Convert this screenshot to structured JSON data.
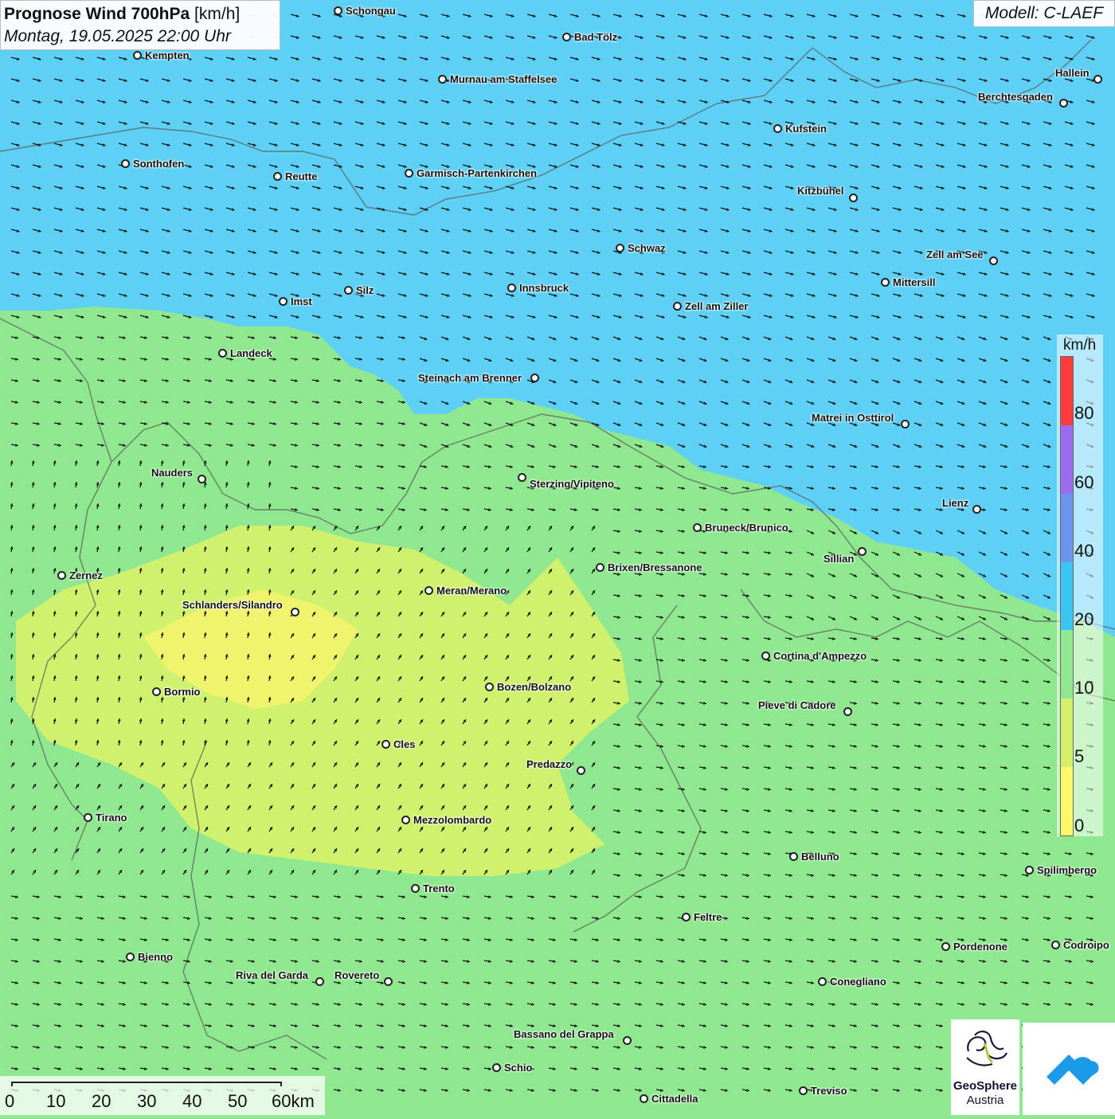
{
  "title": {
    "main": "Prognose Wind 700hPa",
    "unit": "[km/h]",
    "datetime": "Montag, 19.05.2025 22:00 Uhr"
  },
  "model": "Modell: C-LAEF",
  "legend": {
    "unit": "km/h",
    "ticks": [
      "80",
      "60",
      "40",
      "20",
      "10",
      "5",
      "0"
    ],
    "colors": [
      "#ff3b3b",
      "#9a6cf0",
      "#6e95ee",
      "#3ac6f2",
      "#8fe88f",
      "#d4f06a",
      "#fbf86a"
    ]
  },
  "scalebar": {
    "labels": [
      "0",
      "10",
      "20",
      "30",
      "40",
      "50",
      "60km"
    ]
  },
  "logos": {
    "geosphere_line1": "GeoSphere",
    "geosphere_line2": "Austria"
  },
  "cities": [
    {
      "name": "Schongau"
    },
    {
      "name": "Bad Tölz"
    },
    {
      "name": "Kempten"
    },
    {
      "name": "Murnau am Staffelsee"
    },
    {
      "name": "Hallein"
    },
    {
      "name": "Berchtesgaden"
    },
    {
      "name": "Kufstein"
    },
    {
      "name": "Sonthofen"
    },
    {
      "name": "Reutte"
    },
    {
      "name": "Garmisch-Partenkirchen"
    },
    {
      "name": "Kitzbühel"
    },
    {
      "name": "Schwaz"
    },
    {
      "name": "Zell am See"
    },
    {
      "name": "Mittersill"
    },
    {
      "name": "Innsbruck"
    },
    {
      "name": "Silz"
    },
    {
      "name": "Imst"
    },
    {
      "name": "Zell am Ziller"
    },
    {
      "name": "Landeck"
    },
    {
      "name": "Steinach am Brenner"
    },
    {
      "name": "Matrei in Osttirol"
    },
    {
      "name": "Nauders"
    },
    {
      "name": "Sterzing/Vipiteno"
    },
    {
      "name": "Lienz"
    },
    {
      "name": "Bruneck/Brunico"
    },
    {
      "name": "Sillian"
    },
    {
      "name": "Brixen/Bressanone"
    },
    {
      "name": "Zernez"
    },
    {
      "name": "Meran/Merano"
    },
    {
      "name": "Schlanders/Silandro"
    },
    {
      "name": "Cortina d'Ampezzo"
    },
    {
      "name": "Bozen/Bolzano"
    },
    {
      "name": "Bormio"
    },
    {
      "name": "Pieve di Cadore"
    },
    {
      "name": "Cles"
    },
    {
      "name": "Predazzo"
    },
    {
      "name": "Tirano"
    },
    {
      "name": "Mezzolombardo"
    },
    {
      "name": "Belluno"
    },
    {
      "name": "Spilimbergo"
    },
    {
      "name": "Trento"
    },
    {
      "name": "Feltre"
    },
    {
      "name": "Pordenone"
    },
    {
      "name": "Codroipo"
    },
    {
      "name": "Bienno"
    },
    {
      "name": "Riva del Garda"
    },
    {
      "name": "Rovereto"
    },
    {
      "name": "Conegliano"
    },
    {
      "name": "Bassano del Grappa"
    },
    {
      "name": "Schio"
    },
    {
      "name": "Treviso"
    },
    {
      "name": "Cittadella"
    }
  ]
}
